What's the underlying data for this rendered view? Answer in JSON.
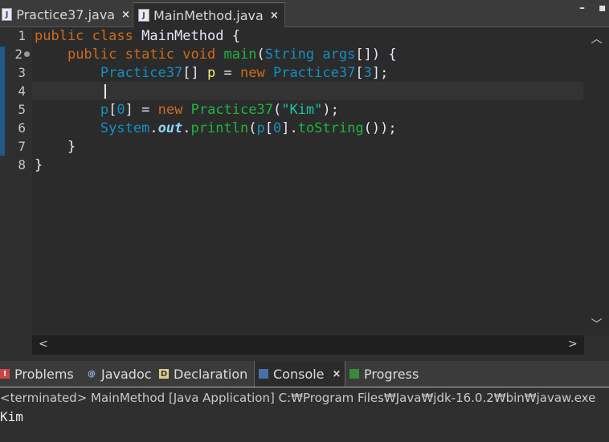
{
  "editor_tabs": [
    {
      "label": "Practice37.java",
      "close": "×",
      "icon": "java-file-icon"
    },
    {
      "label": "MainMethod.java",
      "close": "×",
      "icon": "java-file-icon"
    }
  ],
  "window_controls": {
    "minimize": "–",
    "maximize": "▪"
  },
  "gutter": {
    "line_numbers": [
      "1",
      "2",
      "3",
      "4",
      "5",
      "6",
      "7",
      "8"
    ]
  },
  "code_lines": [
    "public class MainMethod {",
    "    public static void main(String args[]) {",
    "        Practice37[] p = new Practice37[3];",
    "",
    "        p[0] = new Practice37(\"Kim\");",
    "        System.out.println(p[0].toString());",
    "    }",
    "}"
  ],
  "scroll_glyphs": {
    "up": "︿",
    "down": "﹀",
    "left": "<",
    "right": ">"
  },
  "view_tabs": [
    {
      "label": "Problems",
      "icon": "problems-icon"
    },
    {
      "label": "Javadoc",
      "icon": "javadoc-icon"
    },
    {
      "label": "Declaration",
      "icon": "declaration-icon"
    },
    {
      "label": "Console",
      "icon": "console-icon",
      "close": "×"
    },
    {
      "label": "Progress",
      "icon": "progress-icon"
    }
  ],
  "console": {
    "status": "<terminated> MainMethod [Java Application] C:₩Program Files₩Java₩jdk-16.0.2₩bin₩javaw.exe",
    "output": "Kim"
  },
  "colors": {
    "keyword": "#cc6c1d",
    "type": "#1290c3",
    "method": "#1eb540",
    "string": "#17c6a3",
    "local_variable": "#f3ec79",
    "static_field": "#8dd6f9",
    "background": "#2b2b2b"
  }
}
